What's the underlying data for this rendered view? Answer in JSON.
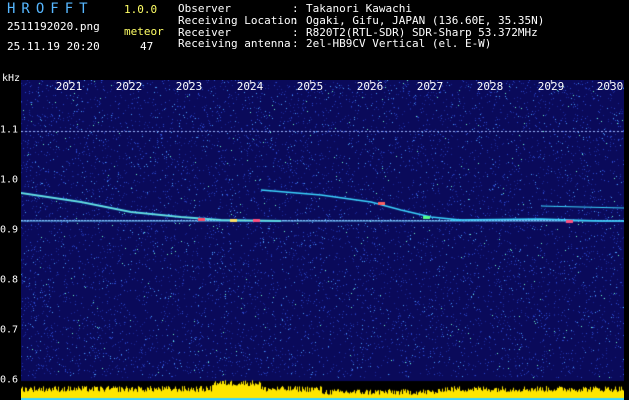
{
  "header": {
    "app_title": "HROFFT",
    "app_version": "1.0.0",
    "file_name": "2511192020.png",
    "datetime": "25.11.19 20:20",
    "meteor_label": "meteor",
    "meteor_count": "47"
  },
  "info": {
    "rows": [
      {
        "label": "Observer",
        "value": "Takanori Kawachi"
      },
      {
        "label": "Receiving Location",
        "value": "Ogaki, Gifu, JAPAN (136.60E, 35.35N)"
      },
      {
        "label": "Receiver",
        "value": "R820T2(RTL-SDR) SDR-Sharp 53.372MHz"
      },
      {
        "label": "Receiving antenna",
        "value": "2el-HB9CV Vertical (el. E-W)"
      }
    ]
  },
  "axis": {
    "unit": "kHz",
    "x_ticks": [
      "2021",
      "2022",
      "2023",
      "2024",
      "2025",
      "2026",
      "2027",
      "2028",
      "2029",
      "2030"
    ],
    "y_ticks": [
      "1.1",
      "1.0",
      "0.9",
      "0.8",
      "0.7",
      "0.6"
    ]
  },
  "colors": {
    "background": "#000000",
    "plot_bg": "#0a0a5a",
    "title": "#56b7ff",
    "label_yellow": "#ffff66",
    "spectrum_yellow": "#ffe600",
    "spectrum_cyan": "#3ad4ff"
  }
}
